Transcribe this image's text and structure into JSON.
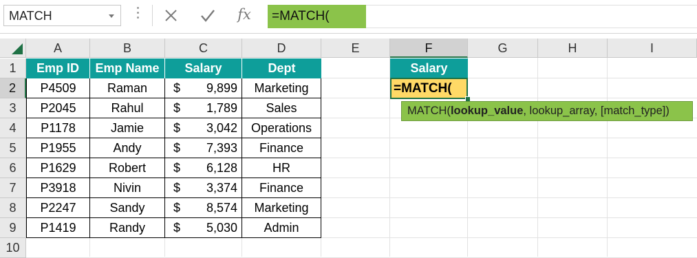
{
  "formula_bar": {
    "name_box": "MATCH",
    "formula": "=MATCH("
  },
  "columns": [
    "A",
    "B",
    "C",
    "D",
    "E",
    "F",
    "G",
    "H",
    "I"
  ],
  "selected_column": "F",
  "rows": [
    "1",
    "2",
    "3",
    "4",
    "5",
    "6",
    "7",
    "8",
    "9",
    "10"
  ],
  "selected_row": "2",
  "table": {
    "headers": [
      "Emp ID",
      "Emp Name",
      "Salary",
      "Dept"
    ],
    "rows": [
      [
        "P4509",
        "Raman",
        "$",
        "9,899",
        "Marketing"
      ],
      [
        "P2045",
        "Rahul",
        "$",
        "1,789",
        "Sales"
      ],
      [
        "P1178",
        "Jamie",
        "$",
        "3,042",
        "Operations"
      ],
      [
        "P1955",
        "Andy",
        "$",
        "7,393",
        "Finance"
      ],
      [
        "P1629",
        "Robert",
        "$",
        "6,128",
        "HR"
      ],
      [
        "P3918",
        "Nivin",
        "$",
        "3,374",
        "Finance"
      ],
      [
        "P2247",
        "Sandy",
        "$",
        "8,574",
        "Marketing"
      ],
      [
        "P1419",
        "Randy",
        "$",
        "5,030",
        "Admin"
      ]
    ]
  },
  "lookup": {
    "header": "Salary",
    "active_cell_text": "=MATCH("
  },
  "tooltip": {
    "prefix": "MATCH(",
    "bold_arg": "lookup_value",
    "rest": ", lookup_array, [match_type])"
  },
  "colors": {
    "header_fill": "#0e9e9a",
    "active_cell_fill": "#ffd966",
    "formula_highlight": "#8bc34a",
    "excel_green": "#1e7145"
  },
  "icons": [
    "dropdown-icon",
    "cancel-icon",
    "enter-icon",
    "fx-icon",
    "select-all-icon"
  ]
}
